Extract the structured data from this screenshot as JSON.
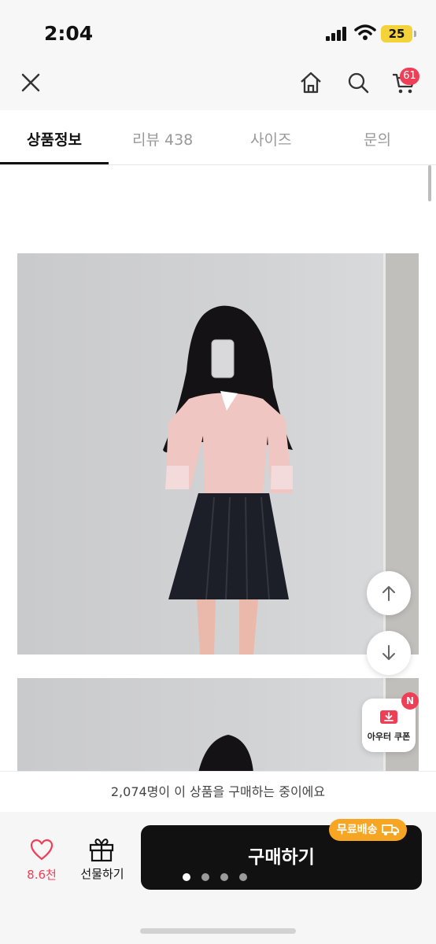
{
  "status_bar": {
    "time": "2:04",
    "battery": "25"
  },
  "app_bar": {
    "icons": [
      "close-icon",
      "home-icon",
      "search-icon",
      "cart-icon"
    ],
    "cart_badge": "61"
  },
  "tabs": [
    {
      "label": "상품정보",
      "active": true
    },
    {
      "label": "리뷰 438",
      "active": false
    },
    {
      "label": "사이즈",
      "active": false
    },
    {
      "label": "문의",
      "active": false
    }
  ],
  "floating": {
    "coupon_label": "아우터 쿠폰",
    "coupon_badge": "N"
  },
  "notice": "2,074명이 이 상품을 구매하는 중이에요",
  "bottom_bar": {
    "like_count": "8.6천",
    "gift_label": "선물하기",
    "buy_label": "구매하기",
    "shipping_badge": "무료배송"
  },
  "colors": {
    "accent": "#ef3f57",
    "cta": "#111111",
    "shipping": "#f6a623"
  }
}
